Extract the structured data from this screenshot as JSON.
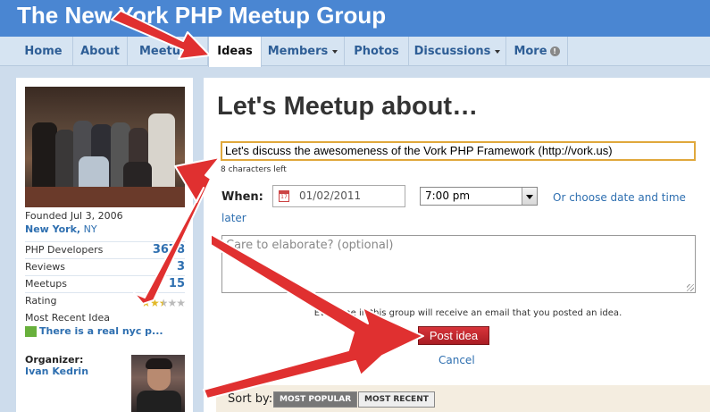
{
  "header": {
    "title": "The New York PHP Meetup Group"
  },
  "nav": {
    "tabs": [
      {
        "label": "Home"
      },
      {
        "label": "About"
      },
      {
        "label": "Meetups"
      },
      {
        "label": "Ideas",
        "active": true
      },
      {
        "label": "Members",
        "dropdown": true
      },
      {
        "label": "Photos"
      },
      {
        "label": "Discussions",
        "dropdown": true
      },
      {
        "label": "More",
        "info": true
      }
    ]
  },
  "sidebar": {
    "founded": "Founded Jul 3, 2006",
    "city": "New York,",
    "state": "NY",
    "stats": [
      {
        "label": "PHP Developers",
        "value": "3678"
      },
      {
        "label": "Reviews",
        "value": "3"
      },
      {
        "label": "Meetups",
        "value": "15"
      }
    ],
    "rating_label": "Rating",
    "rating": 2.5,
    "rating_max": 5,
    "recent_label": "Most Recent Idea",
    "recent_idea": "There is a real nyc p...",
    "organizer_label": "Organizer:",
    "organizer_name": "Ivan Kedrin"
  },
  "main": {
    "heading": "Let's Meetup about…",
    "idea_value": "Let's discuss the awesomeness of the Vork PHP Framework (http://vork.us)",
    "chars_left": "8 characters left",
    "when_label": "When:",
    "date_value": "01/02/2011",
    "time_value": "7:00 pm",
    "choose_link_1": "Or choose date and time",
    "choose_link_2": "later",
    "elaborate_placeholder": "Care to elaborate? (optional)",
    "notice": "Everyone in this group will receive an email that you posted an idea.",
    "post_label": "Post idea",
    "cancel_label": "Cancel",
    "sort_label": "Sort by:",
    "sort_options": [
      "MOST POPULAR",
      "MOST RECENT"
    ]
  },
  "colors": {
    "header_bg": "#4a86d2",
    "accent_link": "#2e6fb0",
    "post_button": "#c0282e",
    "annotation_arrow": "#e03030"
  }
}
